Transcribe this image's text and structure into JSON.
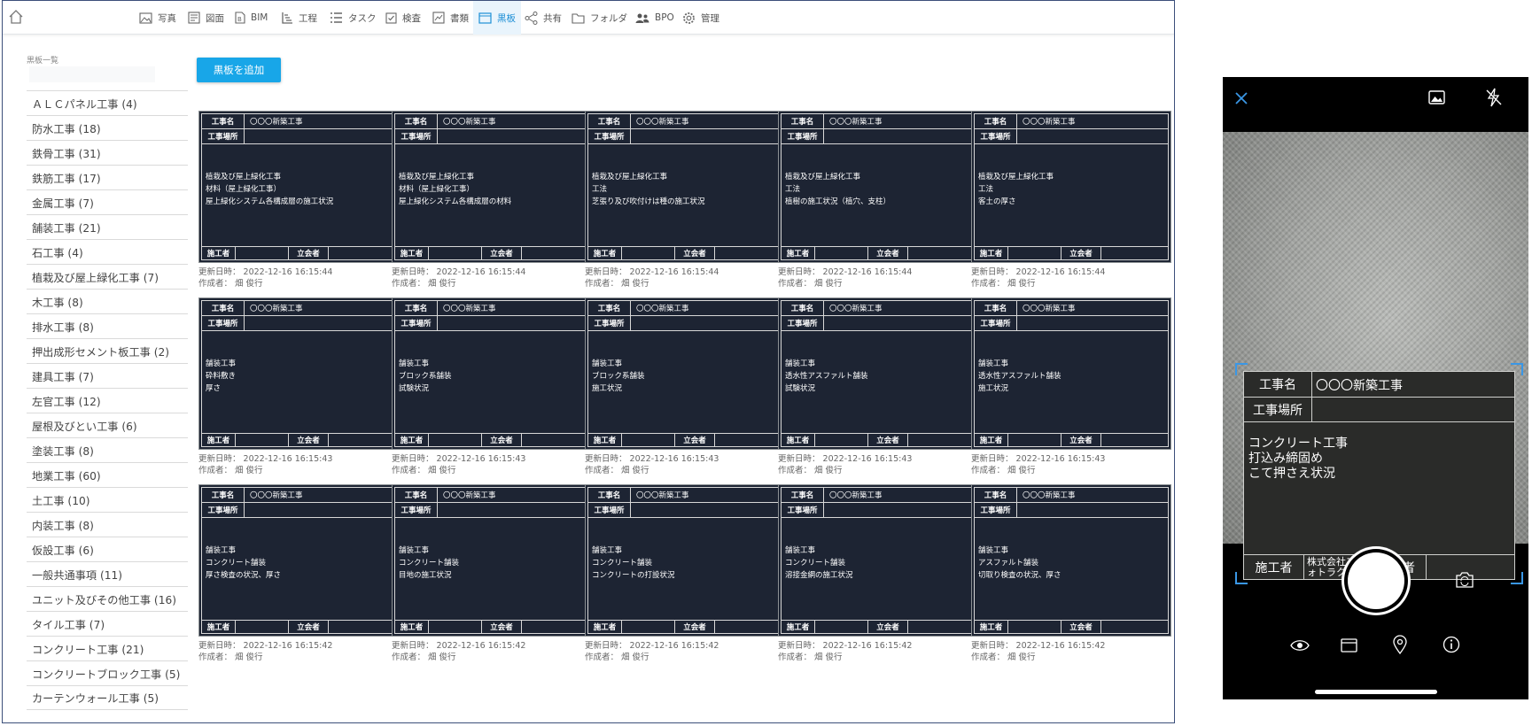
{
  "nav": {
    "items": [
      {
        "label": "写真",
        "icon": "photo-icon"
      },
      {
        "label": "図面",
        "icon": "drawing-icon"
      },
      {
        "label": "BIM",
        "icon": "bim-icon"
      },
      {
        "label": "工程",
        "icon": "schedule-icon"
      },
      {
        "label": "タスク",
        "icon": "task-icon"
      },
      {
        "label": "検査",
        "icon": "inspection-icon"
      },
      {
        "label": "書類",
        "icon": "document-icon"
      },
      {
        "label": "黒板",
        "icon": "blackboard-icon"
      },
      {
        "label": "共有",
        "icon": "share-icon"
      },
      {
        "label": "フォルダ",
        "icon": "folder-icon"
      },
      {
        "label": "BPO",
        "icon": "bpo-icon"
      },
      {
        "label": "管理",
        "icon": "settings-icon"
      }
    ],
    "active_label": "黒板",
    "accent_color": "#1e8fd6"
  },
  "sidebar": {
    "title": "黒板一覧",
    "items": [
      "ＡＬＣパネル工事 (4)",
      "防水工事 (18)",
      "鉄骨工事 (31)",
      "鉄筋工事 (17)",
      "金属工事 (7)",
      "舗装工事 (21)",
      "石工事 (4)",
      "植栽及び屋上緑化工事 (7)",
      "木工事 (8)",
      "排水工事 (8)",
      "押出成形セメント板工事 (2)",
      "建具工事 (7)",
      "左官工事 (12)",
      "屋根及びとい工事 (6)",
      "塗装工事 (8)",
      "地業工事 (60)",
      "土工事 (10)",
      "内装工事 (8)",
      "仮設工事 (6)",
      "一般共通事項 (11)",
      "ユニット及びその他工事 (16)",
      "タイル工事 (7)",
      "コンクリート工事 (21)",
      "コンクリートブロック工事 (5)",
      "カーテンウォール工事 (5)"
    ]
  },
  "add_button": "黒板を追加",
  "board_labels": {
    "name_label": "工事名",
    "place_label": "工事場所",
    "worker_label": "施工者",
    "witness_label": "立会者"
  },
  "boards": [
    {
      "project": "〇〇〇新築工事",
      "lines": [
        "植栽及び屋上緑化工事",
        "材料（屋上緑化工事）",
        "屋上緑化システム各構成層の施工状況"
      ],
      "updated": "更新日時： 2022-12-16 16:15:44",
      "author": "作成者： 畑 俊行"
    },
    {
      "project": "〇〇〇新築工事",
      "lines": [
        "植栽及び屋上緑化工事",
        "材料（屋上緑化工事）",
        "屋上緑化システム各構成層の材料"
      ],
      "updated": "更新日時： 2022-12-16 16:15:44",
      "author": "作成者： 畑 俊行"
    },
    {
      "project": "〇〇〇新築工事",
      "lines": [
        "植栽及び屋上緑化工事",
        "工法",
        "芝張り及び吹付けは種の施工状況"
      ],
      "updated": "更新日時： 2022-12-16 16:15:44",
      "author": "作成者： 畑 俊行"
    },
    {
      "project": "〇〇〇新築工事",
      "lines": [
        "植栽及び屋上緑化工事",
        "工法",
        "植樹の施工状況（植穴、支柱）"
      ],
      "updated": "更新日時： 2022-12-16 16:15:44",
      "author": "作成者： 畑 俊行"
    },
    {
      "project": "〇〇〇新築工事",
      "lines": [
        "植栽及び屋上緑化工事",
        "工法",
        "客土の厚さ"
      ],
      "updated": "更新日時： 2022-12-16 16:15:44",
      "author": "作成者： 畑 俊行"
    },
    {
      "project": "〇〇〇新築工事",
      "lines": [
        "舗装工事",
        "砕料敷き",
        "厚さ"
      ],
      "updated": "更新日時： 2022-12-16 16:15:43",
      "author": "作成者： 畑 俊行"
    },
    {
      "project": "〇〇〇新築工事",
      "lines": [
        "舗装工事",
        "ブロック系舗装",
        "試験状況"
      ],
      "updated": "更新日時： 2022-12-16 16:15:43",
      "author": "作成者： 畑 俊行"
    },
    {
      "project": "〇〇〇新築工事",
      "lines": [
        "舗装工事",
        "ブロック系舗装",
        "施工状況"
      ],
      "updated": "更新日時： 2022-12-16 16:15:43",
      "author": "作成者： 畑 俊行"
    },
    {
      "project": "〇〇〇新築工事",
      "lines": [
        "舗装工事",
        "透水性アスファルト舗装",
        "試験状況"
      ],
      "updated": "更新日時： 2022-12-16 16:15:43",
      "author": "作成者： 畑 俊行"
    },
    {
      "project": "〇〇〇新築工事",
      "lines": [
        "舗装工事",
        "透水性アスファルト舗装",
        "施工状況"
      ],
      "updated": "更新日時： 2022-12-16 16:15:43",
      "author": "作成者： 畑 俊行"
    },
    {
      "project": "〇〇〇新築工事",
      "lines": [
        "舗装工事",
        "コンクリート舗装",
        "厚さ検査の状況、厚さ"
      ],
      "updated": "更新日時： 2022-12-16 16:15:42",
      "author": "作成者： 畑 俊行"
    },
    {
      "project": "〇〇〇新築工事",
      "lines": [
        "舗装工事",
        "コンクリート舗装",
        "目地の施工状況"
      ],
      "updated": "更新日時： 2022-12-16 16:15:42",
      "author": "作成者： 畑 俊行"
    },
    {
      "project": "〇〇〇新築工事",
      "lines": [
        "舗装工事",
        "コンクリート舗装",
        "コンクリートの打設状況"
      ],
      "updated": "更新日時： 2022-12-16 16:15:42",
      "author": "作成者： 畑 俊行"
    },
    {
      "project": "〇〇〇新築工事",
      "lines": [
        "舗装工事",
        "コンクリート舗装",
        "溶接金網の施工状況"
      ],
      "updated": "更新日時： 2022-12-16 16:15:42",
      "author": "作成者： 畑 俊行"
    },
    {
      "project": "〇〇〇新築工事",
      "lines": [
        "舗装工事",
        "アスファルト舗装",
        "切取り検査の状況、厚さ"
      ],
      "updated": "更新日時： 2022-12-16 16:15:42",
      "author": "作成者： 畑 俊行"
    }
  ],
  "phone": {
    "board": {
      "name_label": "工事名",
      "name_value": "〇〇〇新築工事",
      "place_label": "工事場所",
      "lines": [
        "コンクリート工事",
        "打込み締固め",
        "こて押さえ状況"
      ],
      "worker_label": "施工者",
      "worker_value": "株式会社フォトラクション",
      "witness_label": "立会者"
    },
    "icons": [
      "close-icon",
      "gallery-icon",
      "flash-off-icon",
      "switch-camera-icon",
      "eye-icon",
      "blackboard-icon",
      "location-icon",
      "info-icon"
    ],
    "accent_color": "#3a97e6"
  }
}
